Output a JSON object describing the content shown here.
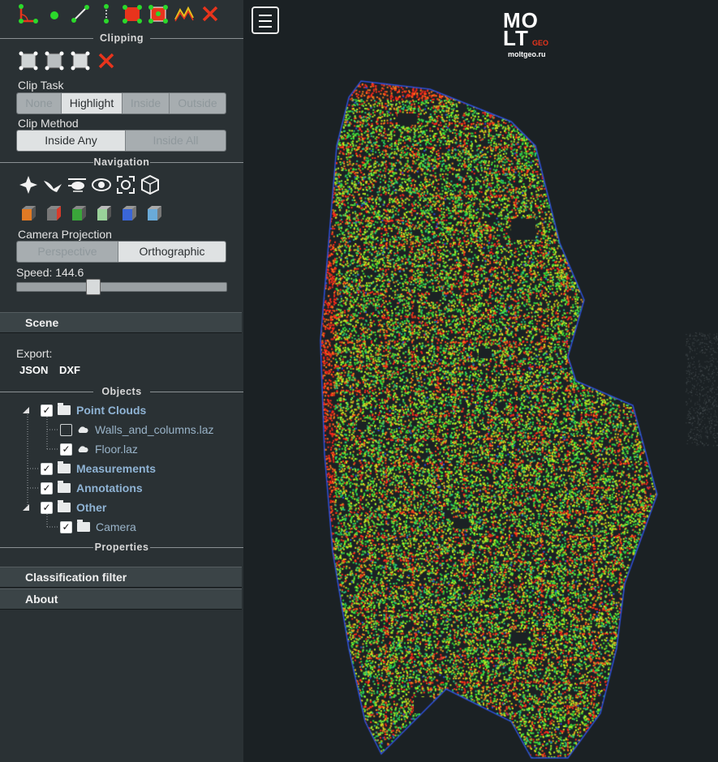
{
  "sidebar": {
    "clipping": {
      "title": "Clipping",
      "clip_task_label": "Clip Task",
      "clip_task_options": [
        "None",
        "Highlight",
        "Inside",
        "Outside"
      ],
      "clip_task_selected": "Highlight",
      "clip_method_label": "Clip Method",
      "clip_method_options": [
        "Inside Any",
        "Inside All"
      ],
      "clip_method_selected": "Inside Any"
    },
    "navigation": {
      "title": "Navigation",
      "camera_projection_label": "Camera Projection",
      "projection_options": [
        "Perspective",
        "Orthographic"
      ],
      "projection_selected": "Orthographic",
      "speed_label": "Speed: 144.6",
      "speed_fraction": 0.35
    },
    "scene_label": "Scene",
    "export": {
      "label": "Export:",
      "json_label": "JSON",
      "dxf_label": "DXF"
    },
    "objects": {
      "title": "Objects",
      "point_clouds": "Point Clouds",
      "walls": "Walls_and_columns.laz",
      "floor": "Floor.laz",
      "measurements": "Measurements",
      "annotations": "Annotations",
      "other": "Other",
      "camera": "Camera"
    },
    "properties_title": "Properties",
    "classification_filter_label": "Classification filter",
    "about_label": "About"
  },
  "logo": {
    "line1": "MO",
    "line2": "LT",
    "sub": "GEO",
    "url": "moltgeo.ru"
  },
  "colors": {
    "accent_red": "#e8341c",
    "point_green": "#35e03a",
    "point_yellow": "#c8f01e",
    "point_red": "#ff2a1a",
    "point_blue": "#2e4fd8"
  }
}
